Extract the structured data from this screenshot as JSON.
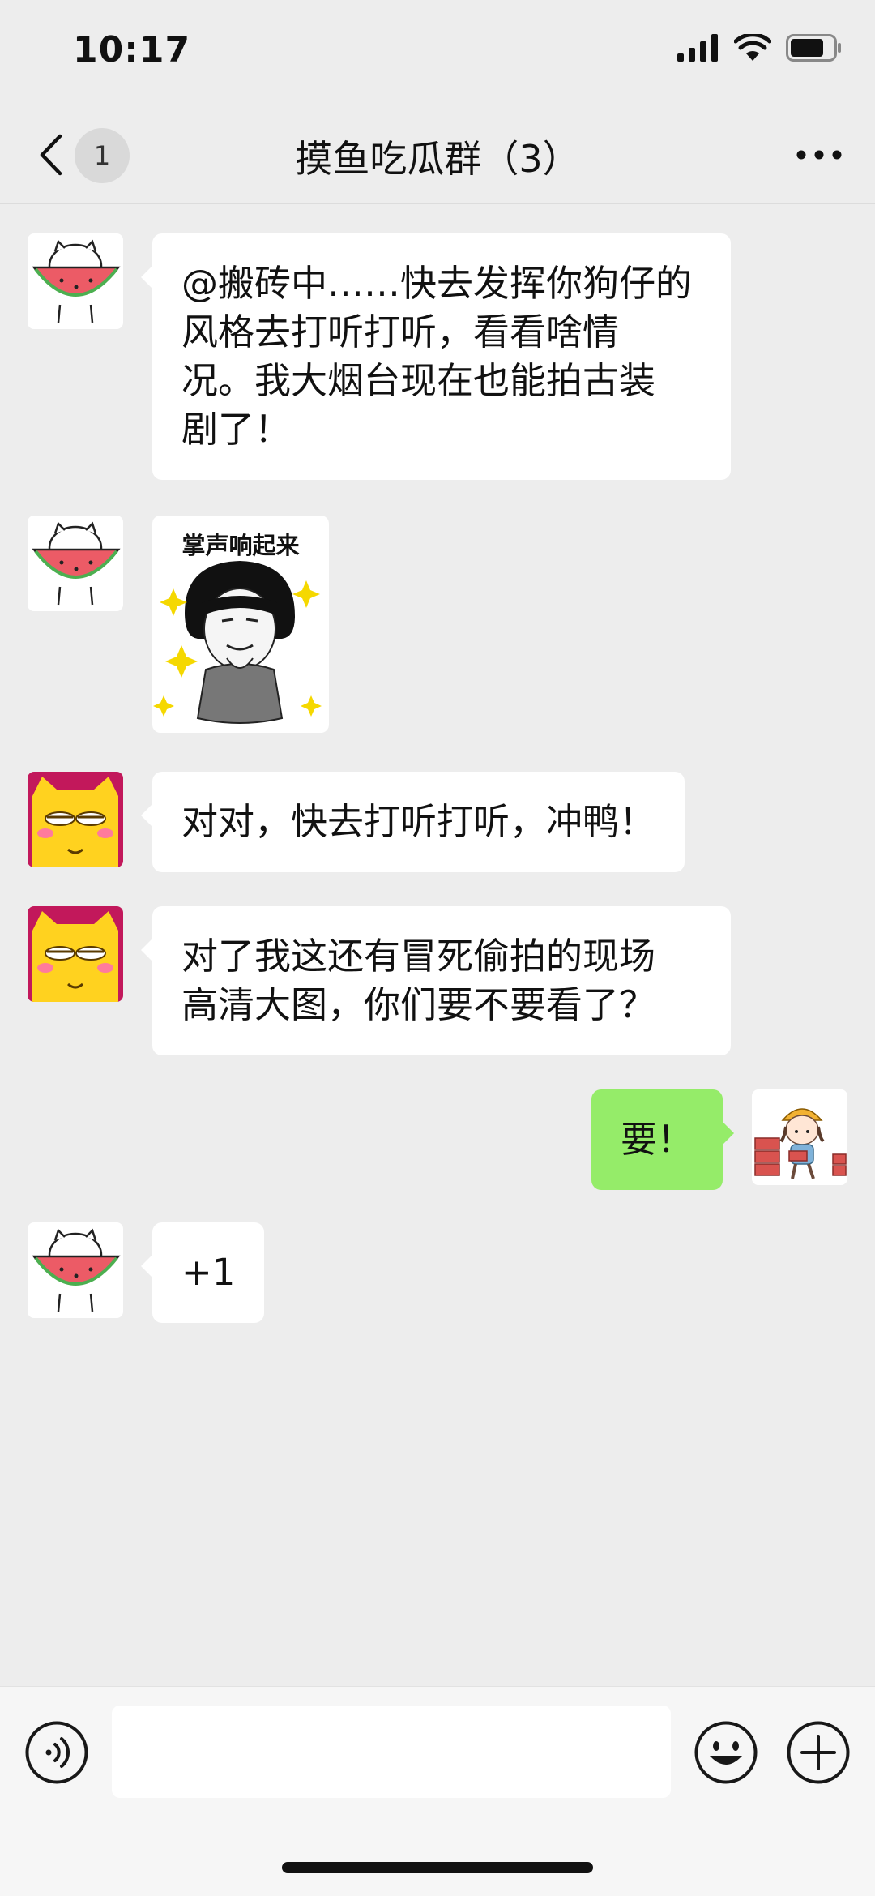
{
  "status_bar": {
    "time": "10:17",
    "icons": [
      "signal-icon",
      "wifi-icon",
      "battery-icon"
    ]
  },
  "nav": {
    "back_icon": "chevron-left-icon",
    "unread_count": "1",
    "title": "摸鱼吃瓜群（3）",
    "more_icon": "more-dots-icon"
  },
  "messages": [
    {
      "side": "left",
      "avatar": "watermelon-cat-avatar",
      "type": "text",
      "lines": [
        "@搬砖中……快去发挥你狗仔的",
        "风格去打听打听，看看啥情",
        "况。我大烟台现在也能拍古装",
        "剧了！"
      ]
    },
    {
      "side": "left",
      "avatar": "watermelon-cat-avatar",
      "type": "sticker",
      "caption": "掌声响起来"
    },
    {
      "side": "left",
      "avatar": "yellow-cat-avatar",
      "type": "text",
      "lines": [
        "对对，快去打听打听，冲鸭！"
      ]
    },
    {
      "side": "left",
      "avatar": "yellow-cat-avatar",
      "type": "text",
      "lines": [
        "对了我这还有冒死偷拍的现场",
        "高清大图，你们要不要看了？"
      ]
    },
    {
      "side": "right",
      "avatar": "worker-girl-avatar",
      "type": "text",
      "lines": [
        "要！"
      ]
    },
    {
      "side": "left",
      "avatar": "watermelon-cat-avatar",
      "type": "text",
      "lines": [
        "+1"
      ]
    }
  ],
  "input_bar": {
    "voice_icon": "voice-icon",
    "input_value": "",
    "emoji_icon": "emoji-icon",
    "plus_icon": "plus-icon"
  },
  "colors": {
    "background": "#ededed",
    "bubble_self": "#95ec69",
    "bubble_other": "#ffffff"
  }
}
